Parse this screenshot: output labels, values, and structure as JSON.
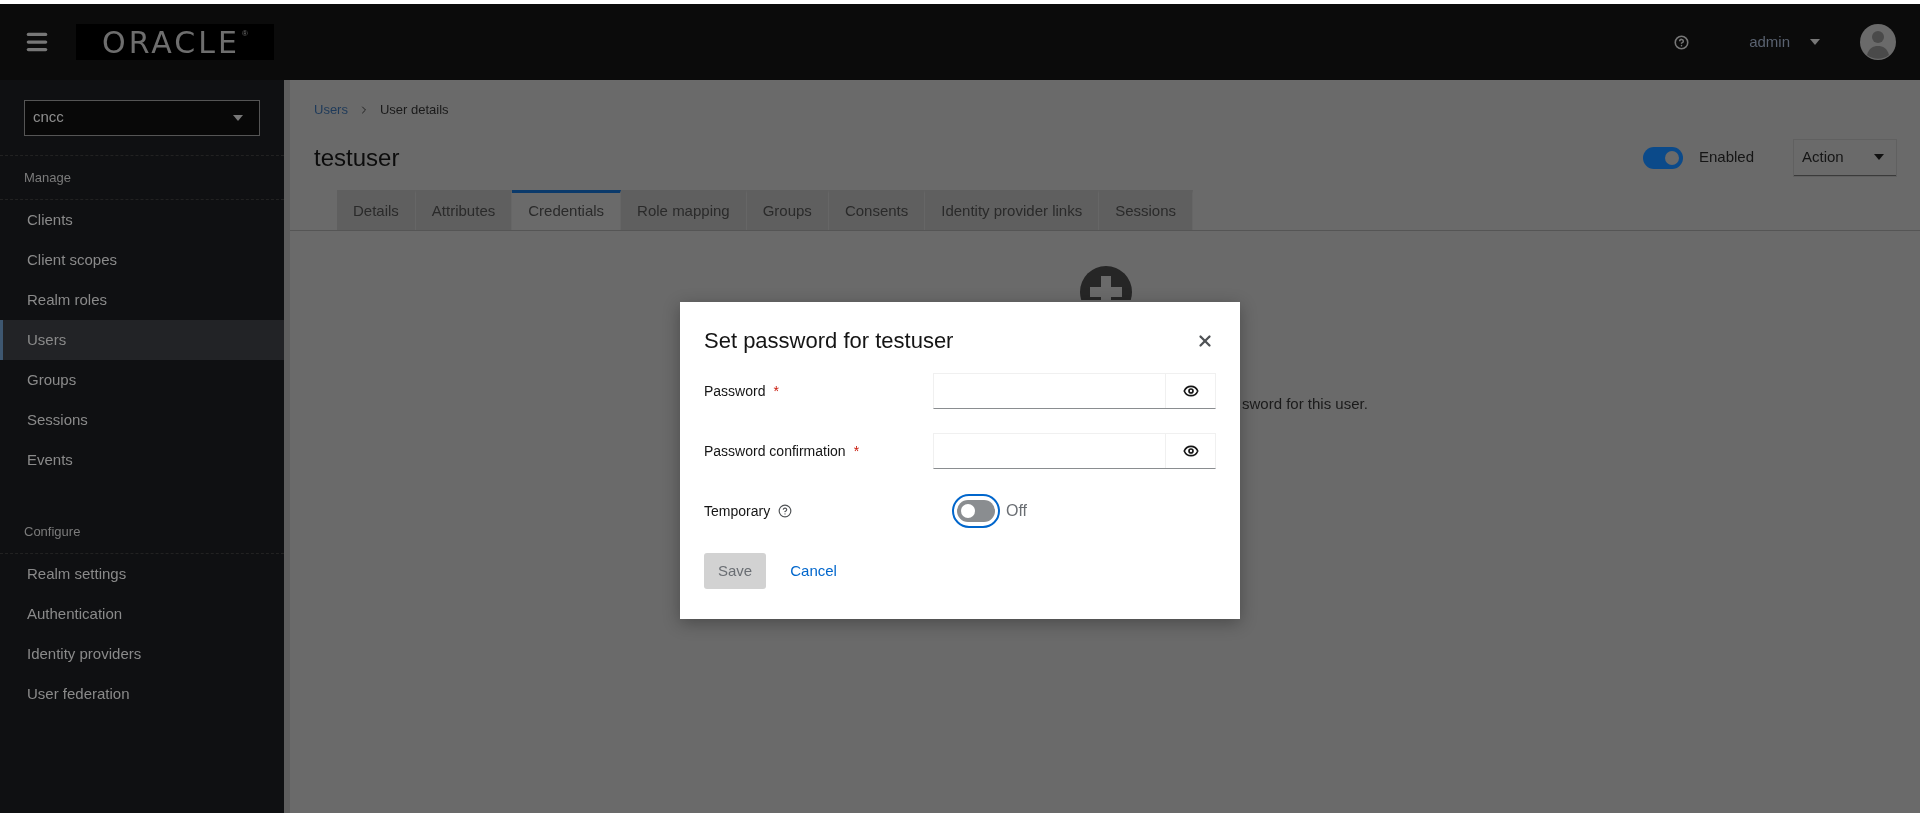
{
  "header": {
    "logo": "ORACLE",
    "logo_mark": "®",
    "user": "admin"
  },
  "sidebar": {
    "realm": "cncc",
    "sections": [
      {
        "title": "Manage",
        "items": [
          {
            "label": "Clients",
            "selected": false
          },
          {
            "label": "Client scopes",
            "selected": false
          },
          {
            "label": "Realm roles",
            "selected": false
          },
          {
            "label": "Users",
            "selected": true
          },
          {
            "label": "Groups",
            "selected": false
          },
          {
            "label": "Sessions",
            "selected": false
          },
          {
            "label": "Events",
            "selected": false
          }
        ]
      },
      {
        "title": "Configure",
        "items": [
          {
            "label": "Realm settings",
            "selected": false
          },
          {
            "label": "Authentication",
            "selected": false
          },
          {
            "label": "Identity providers",
            "selected": false
          },
          {
            "label": "User federation",
            "selected": false
          }
        ]
      }
    ]
  },
  "breadcrumb": [
    "Users",
    "User details"
  ],
  "page": {
    "title": "testuser",
    "enabled": true,
    "enabled_label": "Enabled",
    "action": "Action"
  },
  "tabs": [
    {
      "label": "Details",
      "selected": false
    },
    {
      "label": "Attributes",
      "selected": false
    },
    {
      "label": "Credentials",
      "selected": true
    },
    {
      "label": "Role mapping",
      "selected": false
    },
    {
      "label": "Groups",
      "selected": false
    },
    {
      "label": "Consents",
      "selected": false
    },
    {
      "label": "Identity provider links",
      "selected": false
    },
    {
      "label": "Sessions",
      "selected": false
    }
  ],
  "empty_state": {
    "text": "sword for this user."
  },
  "dialog": {
    "title": "Set password for testuser",
    "fields": [
      {
        "kind": "password",
        "label": "Password",
        "required": true,
        "required_mark": "*"
      },
      {
        "kind": "password",
        "label": "Password confirmation",
        "required": true,
        "required_mark": "*"
      },
      {
        "kind": "switch",
        "label": "Temporary",
        "on": false,
        "status": "Off"
      }
    ],
    "buttons": [
      {
        "kind": "primary",
        "label": "Save",
        "disabled": true
      },
      {
        "kind": "link",
        "label": "Cancel",
        "disabled": false
      }
    ]
  }
}
